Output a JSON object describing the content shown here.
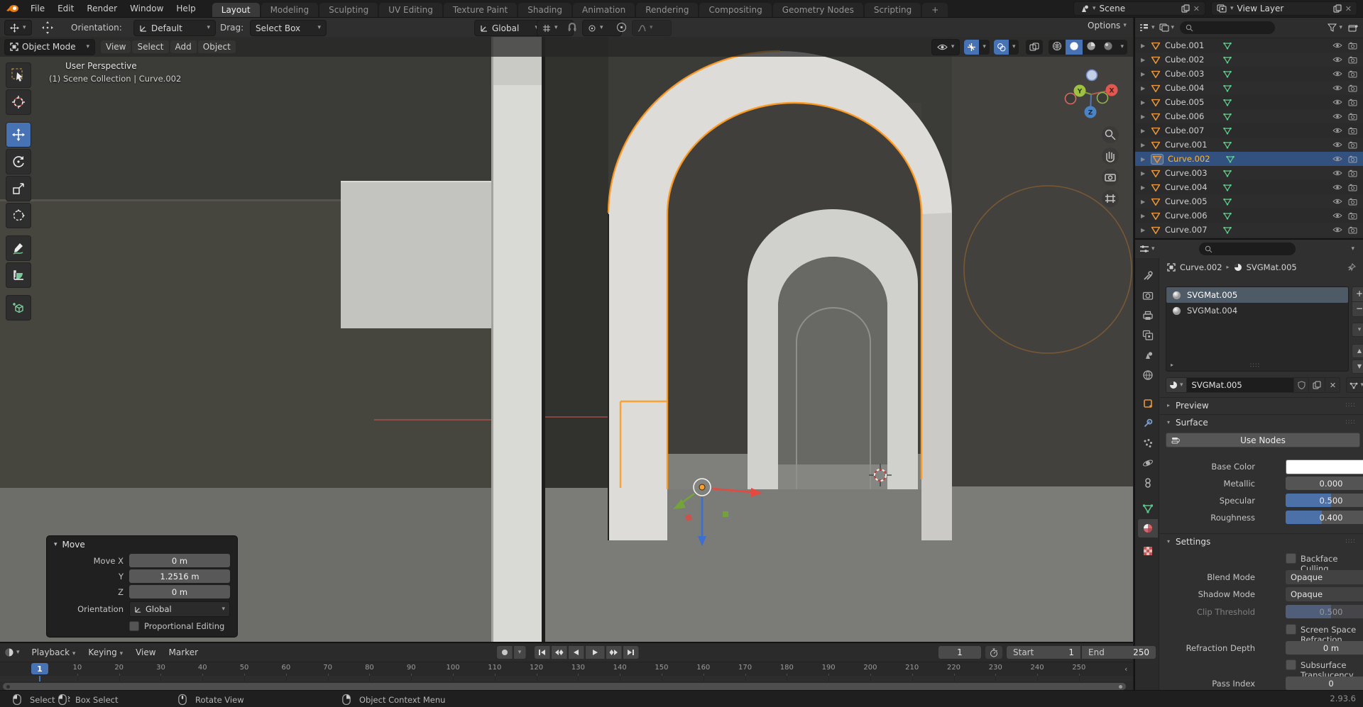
{
  "topbar": {
    "menus": [
      "File",
      "Edit",
      "Render",
      "Window",
      "Help"
    ],
    "tabs": [
      "Layout",
      "Modeling",
      "Sculpting",
      "UV Editing",
      "Texture Paint",
      "Shading",
      "Animation",
      "Rendering",
      "Compositing",
      "Geometry Nodes",
      "Scripting",
      "+"
    ],
    "active_tab": "Layout",
    "scene_label": "Scene",
    "view_layer_label": "View Layer"
  },
  "toolsettings": {
    "orientation_label": "Orientation:",
    "orientation_value": "Default",
    "drag_label": "Drag:",
    "drag_value": "Select Box",
    "transform_orientation": "Global",
    "options_label": "Options"
  },
  "viewport": {
    "mode": "Object Mode",
    "menus": [
      "View",
      "Select",
      "Add",
      "Object"
    ],
    "overlay_line1": "User Perspective",
    "overlay_line2": "(1) Scene Collection | Curve.002",
    "axis_x": "X",
    "axis_y": "Y",
    "axis_z": "Z"
  },
  "move_panel": {
    "title": "Move",
    "fields": [
      {
        "label": "Move X",
        "value": "0 m"
      },
      {
        "label": "Y",
        "value": "1.2516 m"
      },
      {
        "label": "Z",
        "value": "0 m"
      }
    ],
    "orientation_label": "Orientation",
    "orientation_value": "Global",
    "proportional_label": "Proportional Editing"
  },
  "outliner": {
    "items": [
      {
        "name": "Cube.001"
      },
      {
        "name": "Cube.002"
      },
      {
        "name": "Cube.003"
      },
      {
        "name": "Cube.004"
      },
      {
        "name": "Cube.005"
      },
      {
        "name": "Cube.006"
      },
      {
        "name": "Cube.007"
      },
      {
        "name": "Curve.001"
      },
      {
        "name": "Curve.002",
        "selected": true
      },
      {
        "name": "Curve.003"
      },
      {
        "name": "Curve.004"
      },
      {
        "name": "Curve.005"
      },
      {
        "name": "Curve.006"
      },
      {
        "name": "Curve.007"
      }
    ]
  },
  "properties": {
    "tab_icons": [
      "tool",
      "render",
      "output",
      "view-layer",
      "scene",
      "world",
      "object",
      "modifiers",
      "particles",
      "physics",
      "constraints",
      "object-data",
      "material",
      "texture"
    ],
    "active_tab": "material",
    "breadcrumb_object": "Curve.002",
    "breadcrumb_material": "SVGMat.005",
    "slots": [
      {
        "name": "SVGMat.005",
        "selected": true
      },
      {
        "name": "SVGMat.004",
        "selected": false
      }
    ],
    "material_name": "SVGMat.005",
    "preview_label": "Preview",
    "surface_label": "Surface",
    "use_nodes_label": "Use Nodes",
    "base_color_label": "Base Color",
    "metallic_label": "Metallic",
    "metallic_value": "0.000",
    "specular_label": "Specular",
    "specular_value": "0.500",
    "roughness_label": "Roughness",
    "roughness_value": "0.400",
    "settings_label": "Settings",
    "backface_label": "Backface Culling",
    "blend_label": "Blend Mode",
    "blend_value": "Opaque",
    "shadow_label": "Shadow Mode",
    "shadow_value": "Opaque",
    "clip_label": "Clip Threshold",
    "clip_value": "0.500",
    "ssr_label": "Screen Space Refraction",
    "refraction_label": "Refraction Depth",
    "refraction_value": "0 m",
    "sss_label": "Subsurface Translucency",
    "pass_label": "Pass Index",
    "pass_value": "0"
  },
  "timeline": {
    "menus": [
      "Playback",
      "Keying",
      "View",
      "Marker"
    ],
    "current_frame": "1",
    "frame_field": "1",
    "start_label": "Start",
    "start_value": "1",
    "end_label": "End",
    "end_value": "250",
    "tick_labels": [
      10,
      20,
      30,
      40,
      50,
      60,
      70,
      80,
      90,
      100,
      110,
      120,
      130,
      140,
      150,
      160,
      170,
      180,
      190,
      200,
      210,
      220,
      230,
      240,
      250
    ]
  },
  "statusbar": {
    "hints": [
      {
        "label": "Select",
        "mouse": "left"
      },
      {
        "label": "Box Select",
        "mouse": "tweak"
      },
      {
        "label": "Rotate View",
        "mouse": "middle"
      },
      {
        "label": "Object Context Menu",
        "mouse": "right"
      }
    ],
    "version": "2.93.6"
  },
  "colors": {
    "accent_blue": "#4772b3",
    "selection_orange": "#ff9a1f",
    "object_orange": "#e8953c",
    "data_green": "#5fd08c"
  }
}
